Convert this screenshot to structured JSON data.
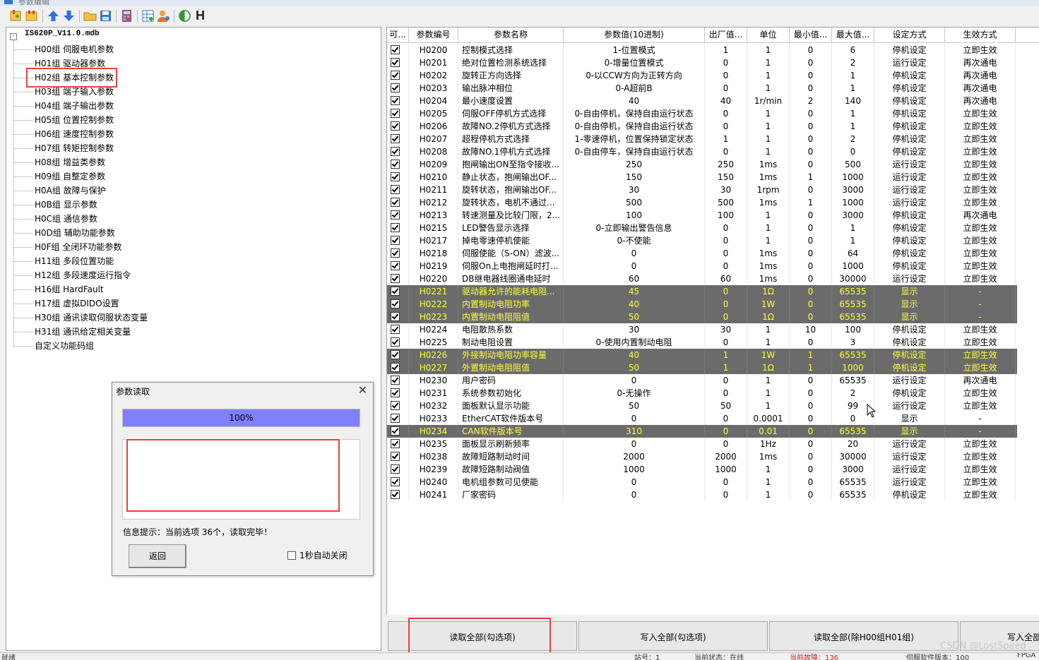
{
  "window": {
    "title": "参数编辑"
  },
  "toolbar": {
    "letter_h": "H"
  },
  "tree": {
    "root_label": "IS620P_V11.0.mdb",
    "expand_symbol": "-",
    "items": [
      "H00组 伺服电机参数",
      "H01组 驱动器参数",
      "H02组 基本控制参数",
      "H03组 端子输入参数",
      "H04组 端子输出参数",
      "H05组 位置控制参数",
      "H06组 速度控制参数",
      "H07组 转矩控制参数",
      "H08组 增益类参数",
      "H09组 自整定参数",
      "H0A组 故障与保护",
      "H0B组 显示参数",
      "H0C组 通信参数",
      "H0D组 辅助功能参数",
      "H0F组 全闭环功能参数",
      "H11组 多段位置功能",
      "H12组 多段速度运行指令",
      "H16组 HardFault",
      "H17组 虚拟DIDO设置",
      "H30组 通讯读取伺服状态变量",
      "H31组 通讯给定相关变量",
      "自定义功能码组"
    ]
  },
  "grid": {
    "columns": [
      "可...",
      "参数编号",
      "参数名称",
      "参数值(10进制)",
      "出厂值...",
      "单位",
      "最小值...",
      "最大值...",
      "设定方式",
      "生效方式"
    ],
    "rows": [
      [
        "H0200",
        "控制模式选择",
        "1-位置模式",
        "1",
        "1",
        "0",
        "6",
        "停机设定",
        "立即生效",
        false
      ],
      [
        "H0201",
        "绝对位置检测系统选择",
        "0-增量位置模式",
        "0",
        "1",
        "0",
        "2",
        "运行设定",
        "再次通电",
        false
      ],
      [
        "H0202",
        "旋转正方向选择",
        "0-以CCW方向为正转方向",
        "0",
        "1",
        "0",
        "1",
        "停机设定",
        "再次通电",
        false
      ],
      [
        "H0203",
        "输出脉冲相位",
        "0-A超前B",
        "0",
        "1",
        "0",
        "1",
        "停机设定",
        "再次通电",
        false
      ],
      [
        "H0204",
        "最小速度设置",
        "40",
        "40",
        "1r/min",
        "2",
        "140",
        "停机设定",
        "再次通电",
        false
      ],
      [
        "H0205",
        "伺服OFF停机方式选择",
        "0-自由停机，保持自由运行状态",
        "0",
        "1",
        "0",
        "1",
        "停机设定",
        "立即生效",
        false
      ],
      [
        "H0206",
        "故障NO.2停机方式选择",
        "0-自由停机，保持自由运行状态",
        "0",
        "1",
        "0",
        "1",
        "停机设定",
        "立即生效",
        false
      ],
      [
        "H0207",
        "超程停机方式选择",
        "1-零速停机，位置保持锁定状态",
        "1",
        "1",
        "0",
        "2",
        "停机设定",
        "立即生效",
        false
      ],
      [
        "H0208",
        "故障NO.1停机方式选择",
        "0-自由停车，保持自由运行状态",
        "0",
        "1",
        "0",
        "0",
        "停机设定",
        "立即生效",
        false
      ],
      [
        "H0209",
        "抱闸输出ON至指令接收...",
        "250",
        "250",
        "1ms",
        "0",
        "500",
        "运行设定",
        "立即生效",
        false
      ],
      [
        "H0210",
        "静止状态，抱闸输出OF...",
        "150",
        "150",
        "1ms",
        "1",
        "1000",
        "运行设定",
        "立即生效",
        false
      ],
      [
        "H0211",
        "旋转状态，抱闸输出OF...",
        "30",
        "30",
        "1rpm",
        "0",
        "3000",
        "运行设定",
        "立即生效",
        false
      ],
      [
        "H0212",
        "旋转状态，电机不通过...",
        "500",
        "500",
        "1ms",
        "1",
        "1000",
        "运行设定",
        "立即生效",
        false
      ],
      [
        "H0213",
        "转速测量及比较门限，2...",
        "100",
        "100",
        "1",
        "0",
        "3000",
        "停机设定",
        "再次通电",
        false
      ],
      [
        "H0215",
        "LED警告显示选择",
        "0-立即输出警告信息",
        "0",
        "1",
        "0",
        "1",
        "停机设定",
        "立即生效",
        false
      ],
      [
        "H0217",
        "掉电零速停机使能",
        "0-不使能",
        "0",
        "1",
        "0",
        "1",
        "停机设定",
        "立即生效",
        false
      ],
      [
        "H0218",
        "伺服使能（S-ON）滤波...",
        "0",
        "0",
        "1ms",
        "0",
        "64",
        "停机设定",
        "立即生效",
        false
      ],
      [
        "H0219",
        "伺服On上电抱闸延时打...",
        "0",
        "0",
        "1ms",
        "0",
        "1000",
        "停机设定",
        "立即生效",
        false
      ],
      [
        "H0220",
        "DB继电器线圈通电延时",
        "60",
        "60",
        "1ms",
        "0",
        "30000",
        "运行设定",
        "立即生效",
        false
      ],
      [
        "H0221",
        "驱动器允许的能耗电阻...",
        "45",
        "0",
        "1Ω",
        "0",
        "65535",
        "显示",
        "-",
        true
      ],
      [
        "H0222",
        "内置制动电阻功率",
        "40",
        "0",
        "1W",
        "0",
        "65535",
        "显示",
        "-",
        true
      ],
      [
        "H0223",
        "内置制动电阻阻值",
        "50",
        "0",
        "1Ω",
        "0",
        "65535",
        "显示",
        "-",
        true
      ],
      [
        "H0224",
        "电阻散热系数",
        "30",
        "30",
        "1",
        "10",
        "100",
        "停机设定",
        "立即生效",
        false
      ],
      [
        "H0225",
        "制动电阻设置",
        "0-使用内置制动电阻",
        "0",
        "1",
        "0",
        "3",
        "停机设定",
        "立即生效",
        false
      ],
      [
        "H0226",
        "外接制动电阻功率容量",
        "40",
        "1",
        "1W",
        "1",
        "65535",
        "停机设定",
        "立即生效",
        true
      ],
      [
        "H0227",
        "外置制动电阻阻值",
        "50",
        "1",
        "1Ω",
        "1",
        "1000",
        "停机设定",
        "立即生效",
        true
      ],
      [
        "H0230",
        "用户密码",
        "0",
        "0",
        "1",
        "0",
        "65535",
        "运行设定",
        "再次通电",
        false
      ],
      [
        "H0231",
        "系统参数初始化",
        "0-无操作",
        "0",
        "1",
        "0",
        "2",
        "停机设定",
        "立即生效",
        false
      ],
      [
        "H0232",
        "面板默认显示功能",
        "50",
        "50",
        "1",
        "0",
        "99",
        "运行设定",
        "立即生效",
        false
      ],
      [
        "H0233",
        "EtherCAT软件版本号",
        "0",
        "0",
        "0.0001",
        "0",
        "0",
        "显示",
        "-",
        false
      ],
      [
        "H0234",
        "CAN软件版本号",
        "310",
        "0",
        "0.01",
        "0",
        "65535",
        "显示",
        "-",
        true
      ],
      [
        "H0235",
        "面板显示刷新频率",
        "0",
        "0",
        "1Hz",
        "0",
        "20",
        "运行设定",
        "立即生效",
        false
      ],
      [
        "H0238",
        "故障短路制动时间",
        "2000",
        "2000",
        "1ms",
        "0",
        "30000",
        "运行设定",
        "立即生效",
        false
      ],
      [
        "H0239",
        "故障短路制动阀值",
        "1000",
        "1000",
        "1",
        "0",
        "3000",
        "运行设定",
        "立即生效",
        false
      ],
      [
        "H0240",
        "电机组参数可见使能",
        "0",
        "0",
        "1",
        "0",
        "65535",
        "运行设定",
        "立即生效",
        false
      ],
      [
        "H0241",
        "厂家密码",
        "0",
        "0",
        "1",
        "0",
        "65535",
        "停机设定",
        "立即生效",
        false
      ]
    ]
  },
  "bottom_buttons": [
    "读取全部(勾选项)",
    "写入全部(勾选项)",
    "读取全部(除H00组H01组)",
    "写入全部"
  ],
  "dialog": {
    "title": "参数读取",
    "close_symbol": "✕",
    "progress_fraction": 1.0,
    "progress_text": "100%",
    "info": "信息提示：当前选项 36个，读取完毕！",
    "back_label": "返回",
    "auto_close_label": "1秒自动关闭"
  },
  "status_bar": {
    "left": "就绪",
    "station": "站号：1",
    "state": "当前状态：在线",
    "fault": "当前故障：136",
    "version": "伺服软件版本：100",
    "right": "FPGA版"
  },
  "watermark": "CSDN @LostSpeed",
  "colors": {
    "highlight_row_bg": "#6b6b6b",
    "highlight_row_text": "#ffff3a",
    "progress_fill": "#8080ff",
    "annotation_red": "#e84040"
  }
}
